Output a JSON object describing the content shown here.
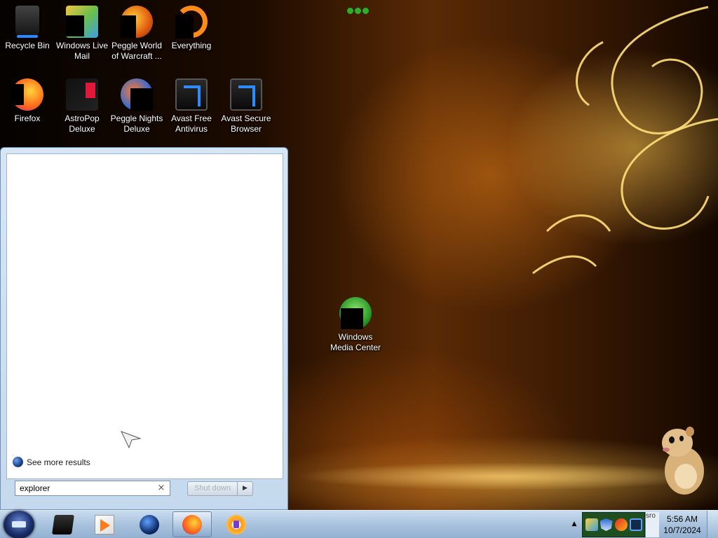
{
  "desktop": {
    "icons": [
      {
        "label": "Recycle Bin",
        "icon": "recycle-bin-icon"
      },
      {
        "label": "Windows Live Mail",
        "icon": "mail-icon"
      },
      {
        "label": "Peggle World of Warcraft ...",
        "icon": "peggle-wow-icon"
      },
      {
        "label": "Everything",
        "icon": "everything-icon"
      },
      {
        "label": "Firefox",
        "icon": "firefox-icon"
      },
      {
        "label": "AstroPop Deluxe",
        "icon": "astropop-icon"
      },
      {
        "label": "Peggle Nights Deluxe",
        "icon": "peggle-nights-icon"
      },
      {
        "label": "Avast Free Antivirus",
        "icon": "avast-antivirus-icon"
      },
      {
        "label": "Avast Secure Browser",
        "icon": "avast-browser-icon"
      },
      {
        "label": "Windows Media Center",
        "icon": "media-center-icon"
      }
    ]
  },
  "start_menu": {
    "see_more_results": "See more results",
    "search_value": "explorer",
    "clear_glyph": "×",
    "shutdown_label": "Shut down",
    "shutdown_arrow": "▶"
  },
  "taskbar": {
    "pinned": [
      {
        "name": "windows-explorer",
        "icon": "explorer-icon",
        "active": false
      },
      {
        "name": "media-player",
        "icon": "media-player-icon",
        "active": false
      },
      {
        "name": "globe-app",
        "icon": "globe-icon",
        "active": false
      },
      {
        "name": "firefox",
        "icon": "firefox-icon",
        "active": true
      },
      {
        "name": "avast-secure-browser",
        "icon": "avast-browser-icon",
        "active": false
      }
    ],
    "tray": {
      "chevron": "▲",
      "strip_text": "sro"
    },
    "clock": {
      "time": "5:56 AM",
      "date": "10/7/2024"
    }
  },
  "colors": {
    "taskbar_top": "#c9dcef",
    "taskbar_bottom": "#93b1d2",
    "start_panel": "#d6e6f5",
    "wallpaper_accent": "#ffe07a",
    "tray_background": "#1f4f20"
  }
}
